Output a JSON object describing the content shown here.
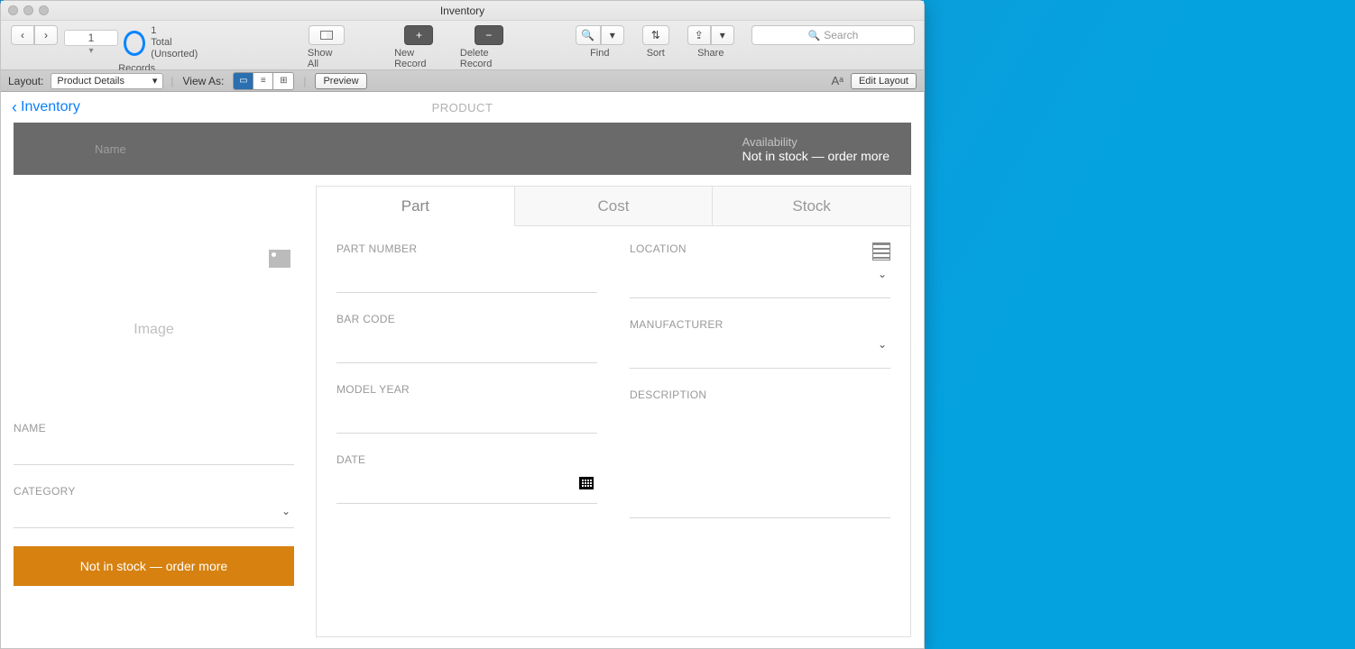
{
  "window": {
    "title": "Inventory"
  },
  "toolbar": {
    "record_index": "1",
    "record_total": "1",
    "record_sort": "Total (Unsorted)",
    "records_label": "Records",
    "show_all": "Show All",
    "new_record": "New Record",
    "delete_record": "Delete Record",
    "find": "Find",
    "sort": "Sort",
    "share": "Share",
    "search_placeholder": "Search"
  },
  "subtoolbar": {
    "layout_label": "Layout:",
    "layout_value": "Product Details",
    "viewas_label": "View As:",
    "preview": "Preview",
    "edit_layout": "Edit Layout"
  },
  "breadcrumb": {
    "back": "Inventory",
    "heading": "PRODUCT"
  },
  "banner": {
    "name_label": "Name",
    "availability_label": "Availability",
    "availability_value": "Not in stock — order more"
  },
  "left": {
    "image_placeholder": "Image",
    "name_label": "NAME",
    "category_label": "CATEGORY",
    "stock_button": "Not in stock — order more"
  },
  "tabs": {
    "part": "Part",
    "cost": "Cost",
    "stock": "Stock"
  },
  "form": {
    "part_number": "PART NUMBER",
    "bar_code": "BAR CODE",
    "model_year": "MODEL YEAR",
    "date": "DATE",
    "location": "LOCATION",
    "manufacturer": "MANUFACTURER",
    "description": "DESCRIPTION"
  }
}
